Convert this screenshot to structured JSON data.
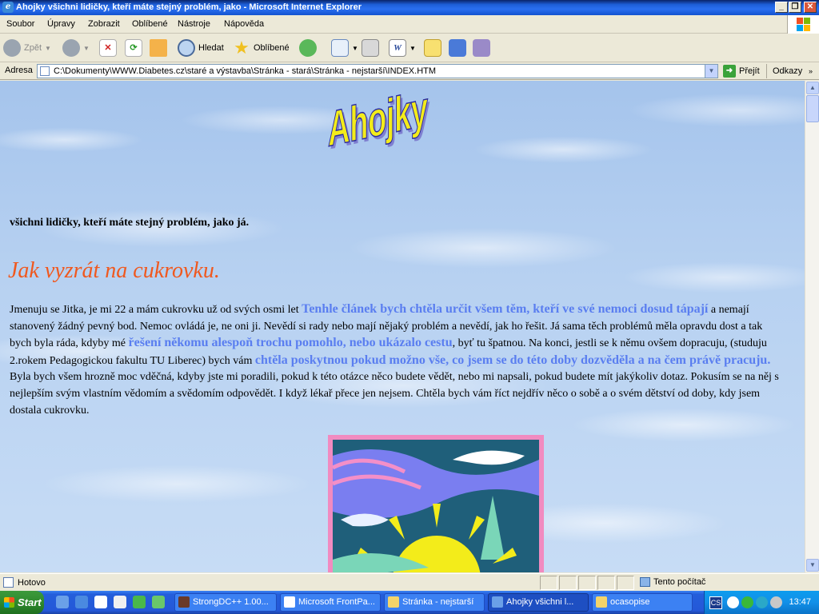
{
  "window": {
    "title": "Ahojky všichni lidičky, kteří máte stejný problém, jako - Microsoft Internet Explorer",
    "min": "_",
    "max": "❐",
    "close": "✕"
  },
  "menu": {
    "items": [
      "Soubor",
      "Úpravy",
      "Zobrazit",
      "Oblíbené",
      "Nástroje",
      "Nápověda"
    ]
  },
  "toolbar": {
    "back": "Zpět",
    "search": "Hledat",
    "favorites": "Oblíbené"
  },
  "address": {
    "label": "Adresa",
    "value": "C:\\Dokumenty\\WWW.Diabetes.cz\\staré a výstavba\\Stránka - stará\\Stránka - nejstarší\\INDEX.HTM",
    "go": "Přejít",
    "links": "Odkazy"
  },
  "page": {
    "logo_text": "Ahojky",
    "intro": "všichni lidičky, kteří máte stejný problém, jako já.",
    "heading": "Jak vyzrát na cukrovku.",
    "p1": "Jmenuju se Jitka, je mi 22 a mám cukrovku už od svých osmi let ",
    "hl1": "Tenhle článek bych chtěla určit všem těm, kteří ve své nemoci dosud tápají",
    "p2": " a nemají stanovený žádný pevný bod. Nemoc ovládá je, ne oni ji. Nevědí si rady nebo mají nějaký problém a nevědí, jak ho řešit. Já sama těch problémů měla opravdu dost a tak bych byla ráda, kdyby mé ",
    "hl2": "řešení někomu alespoň trochu pomohlo, nebo ukázalo cestu",
    "p3": ", byť tu špatnou. Na konci, jestli se k němu ovšem dopracuju, (studuju 2.rokem Pedagogickou fakultu TU Liberec) bych vám ",
    "hl3": "chtěla poskytnou pokud možno vše, co jsem se do této doby dozvěděla a na čem právě pracuju.",
    "p4": " Byla bych všem hrozně moc vděčná, kdyby jste mi poradili, pokud k této otázce něco budete vědět, nebo mi napsali, pokud budete mít jakýkoliv dotaz. Pokusím se na něj s nejlepším svým vlastním vědomím a svědomím odpovědět. I když lékař přece jen nejsem. Chtěla bych vám říct nejdřív něco o sobě a o svém dětství od doby, kdy jsem dostala cukrovku."
  },
  "status": {
    "text": "Hotovo",
    "zone": "Tento počítač"
  },
  "taskbar": {
    "start": "Start",
    "tasks": [
      "StrongDC++ 1.00...",
      "Microsoft FrontPa...",
      "Stránka - nejstarší",
      "Ahojky všichni l...",
      "ocasopise"
    ],
    "active_index": 3,
    "tray_label": "CS",
    "clock": "13:47"
  },
  "colors": {
    "heading": "#f0581e",
    "highlight": "#5a7ef0",
    "logo": "#f3ec1a"
  }
}
